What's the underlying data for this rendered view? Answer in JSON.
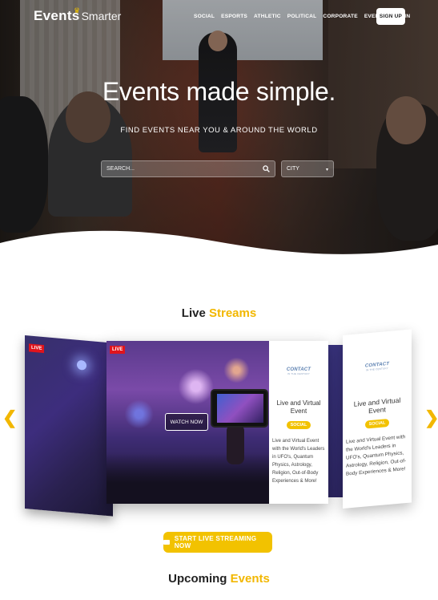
{
  "brand": {
    "word1": "Events",
    "word2": "Smarter"
  },
  "nav": {
    "items": [
      "SOCIAL",
      "ESPORTS",
      "ATHLETIC",
      "POLITICAL",
      "CORPORATE",
      "EVENTS",
      "LOGIN"
    ],
    "signup": "SIGN UP"
  },
  "hero": {
    "title": "Events made simple.",
    "subtitle": "FIND EVENTS NEAR YOU & AROUND THE WORLD",
    "search_placeholder": "SEARCH...",
    "city": "CITY"
  },
  "live_streams": {
    "title_a": "Live ",
    "title_b": "Streams",
    "badge": "LIVE",
    "watch_label": "WATCH NOW",
    "cards": [
      {
        "brand_name": "CONTACT",
        "brand_tagline": "IN THE CENTURY",
        "title": "Live and Virtual Event",
        "tag": "SOCIAL",
        "description": "Live and Virtual Event with the World's Leaders in UFO's, Quantum Physics, Astrology, Religion, Out-of-Body Experiences & More!"
      },
      {
        "brand_name": "CONTACT",
        "brand_tagline": "IN THE CENTURY",
        "title": "Live and Virtual Event",
        "tag": "SOCIAL",
        "description": "Live and Virtual Event with the World's Leaders in UFO's, Quantum Physics, Astrology, Religion, Out-of-Body Experiences & More!"
      }
    ],
    "cta": "START LIVE STREAMING NOW"
  },
  "upcoming": {
    "title_a": "Upcoming ",
    "title_b": "Events"
  },
  "colors": {
    "accent": "#f2c200",
    "live": "#e0141c"
  },
  "icons": {
    "prev": "chevron-left-icon",
    "next": "chevron-right-icon",
    "search": "search-icon",
    "camera": "video-camera-icon"
  }
}
